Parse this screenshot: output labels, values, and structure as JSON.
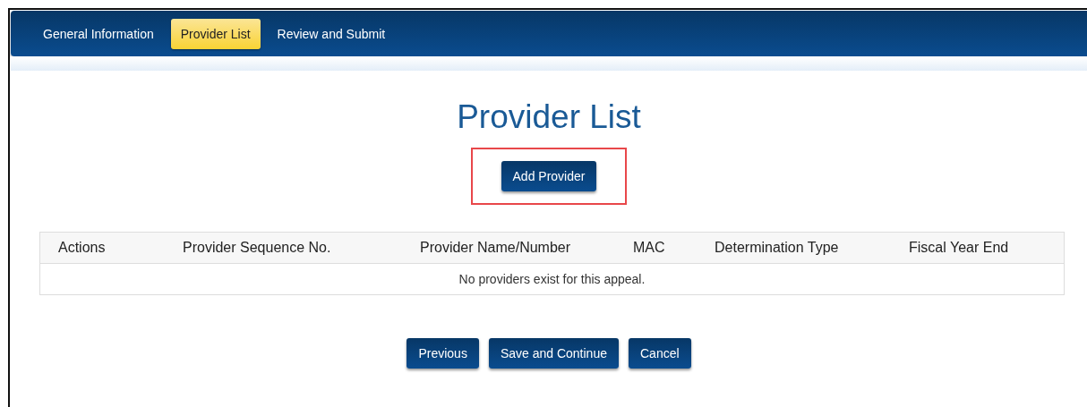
{
  "tabs": [
    {
      "label": "General Information",
      "selected": false
    },
    {
      "label": "Provider List",
      "selected": true
    },
    {
      "label": "Review and Submit",
      "selected": false
    }
  ],
  "title": "Provider List",
  "add_button": "Add Provider",
  "table": {
    "columns": [
      "Actions",
      "Provider Sequence No.",
      "Provider Name/Number",
      "MAC",
      "Determination Type",
      "Fiscal Year End"
    ],
    "empty_message": "No providers exist for this appeal."
  },
  "buttons": [
    "Previous",
    "Save and Continue",
    "Cancel"
  ]
}
